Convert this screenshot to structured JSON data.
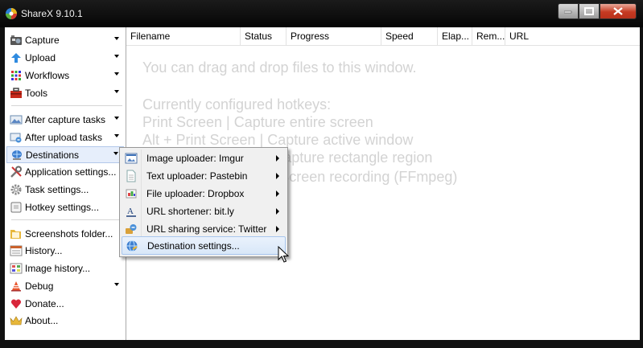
{
  "window": {
    "title": "ShareX 9.10.1"
  },
  "sidebar": {
    "items": [
      {
        "label": "Capture",
        "icon": "camera-icon",
        "has_submenu": true
      },
      {
        "label": "Upload",
        "icon": "upload-arrow-icon",
        "has_submenu": true
      },
      {
        "label": "Workflows",
        "icon": "grid-icon",
        "has_submenu": true
      },
      {
        "label": "Tools",
        "icon": "toolbox-icon",
        "has_submenu": true
      },
      {
        "label": "After capture tasks",
        "icon": "image-tasks-icon",
        "has_submenu": true
      },
      {
        "label": "After upload tasks",
        "icon": "link-tasks-icon",
        "has_submenu": true
      },
      {
        "label": "Destinations",
        "icon": "globe-icon",
        "has_submenu": true,
        "selected": true
      },
      {
        "label": "Application settings...",
        "icon": "wrench-icon"
      },
      {
        "label": "Task settings...",
        "icon": "gear-icon"
      },
      {
        "label": "Hotkey settings...",
        "icon": "keyboard-icon"
      },
      {
        "label": "Screenshots folder...",
        "icon": "folder-icon"
      },
      {
        "label": "History...",
        "icon": "history-icon"
      },
      {
        "label": "Image history...",
        "icon": "image-history-icon"
      },
      {
        "label": "Debug",
        "icon": "cone-icon",
        "has_submenu": true
      },
      {
        "label": "Donate...",
        "icon": "heart-icon"
      },
      {
        "label": "About...",
        "icon": "crown-icon"
      }
    ]
  },
  "list": {
    "columns": [
      "Filename",
      "Status",
      "Progress",
      "Speed",
      "Elap...",
      "Rem...",
      "URL"
    ],
    "hint_lines": [
      "You can drag and drop files to this window.",
      "Currently configured hotkeys:",
      "Print Screen  |  Capture entire screen",
      "Alt + Print Screen  |  Capture active window",
      "Ctrl + Print Screen  |  Capture rectangle region",
      "Shift + Print Screen  |  Screen recording (FFmpeg)"
    ]
  },
  "submenu": {
    "items": [
      {
        "label": "Image uploader: Imgur",
        "icon": "image-uploader-icon",
        "has_submenu": true
      },
      {
        "label": "Text uploader: Pastebin",
        "icon": "text-document-icon",
        "has_submenu": true
      },
      {
        "label": "File uploader: Dropbox",
        "icon": "file-uploader-icon",
        "has_submenu": true
      },
      {
        "label": "URL shortener: bit.ly",
        "icon": "url-shortener-icon",
        "has_submenu": true
      },
      {
        "label": "URL sharing service: Twitter",
        "icon": "sharing-icon",
        "has_submenu": true
      },
      {
        "label": "Destination settings...",
        "icon": "globe-settings-icon",
        "highlighted": true
      }
    ]
  },
  "colors": {
    "hint_text": "#d3d3d3",
    "selection_bg": "#e6eefb",
    "titlebar": "#0a0a0a"
  }
}
